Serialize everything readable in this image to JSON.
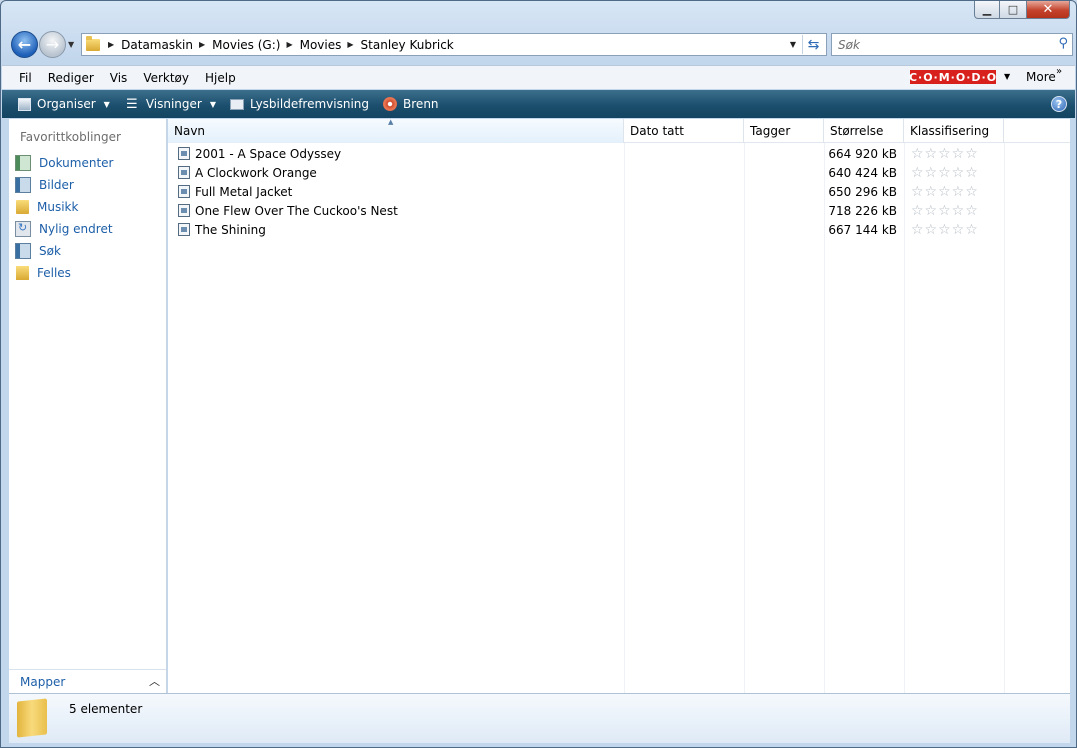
{
  "window": {
    "minimize_label": "▁",
    "maximize_label": "□",
    "close_label": "✕"
  },
  "address": {
    "crumbs": [
      "Datamaskin",
      "Movies (G:)",
      "Movies",
      "Stanley Kubrick"
    ],
    "search_placeholder": "Søk"
  },
  "menu": {
    "items": [
      "Fil",
      "Rediger",
      "Vis",
      "Verktøy",
      "Hjelp"
    ],
    "comodo": "C·O·M·O·D·O",
    "more": "More"
  },
  "toolbar": {
    "organise": "Organiser",
    "views": "Visninger",
    "slideshow": "Lysbildefremvisning",
    "burn": "Brenn"
  },
  "nav": {
    "heading": "Favorittkoblinger",
    "items": [
      "Dokumenter",
      "Bilder",
      "Musikk",
      "Nylig endret",
      "Søk",
      "Felles"
    ],
    "folders_label": "Mapper"
  },
  "columns": [
    "Navn",
    "Dato tatt",
    "Tagger",
    "Størrelse",
    "Klassifisering"
  ],
  "files": [
    {
      "name": "2001 - A Space Odyssey",
      "size": "664 920 kB",
      "rating": 0
    },
    {
      "name": "A Clockwork Orange",
      "size": "640 424 kB",
      "rating": 0
    },
    {
      "name": "Full Metal Jacket",
      "size": "650 296 kB",
      "rating": 0
    },
    {
      "name": "One Flew Over The Cuckoo's Nest",
      "size": "718 226 kB",
      "rating": 0
    },
    {
      "name": "The Shining",
      "size": "667 144 kB",
      "rating": 0
    }
  ],
  "details": {
    "count": "5 elementer"
  }
}
